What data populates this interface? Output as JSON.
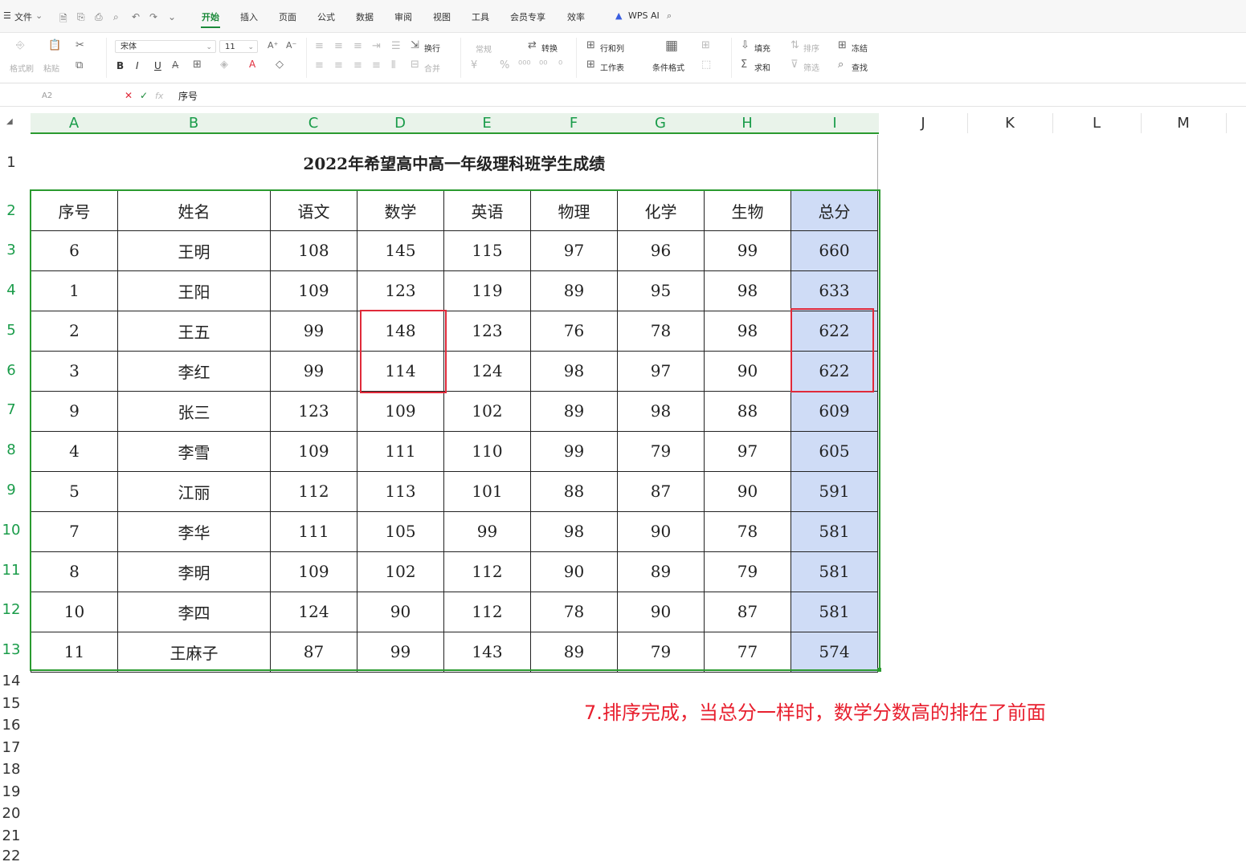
{
  "menubar": {
    "file_label": "文件",
    "tabs": [
      "开始",
      "插入",
      "页面",
      "公式",
      "数据",
      "审阅",
      "视图",
      "工具",
      "会员专享",
      "效率"
    ],
    "active_tab": "开始",
    "ai_label": "WPS AI"
  },
  "toolbar": {
    "format_painter": "格式刷",
    "paste": "粘贴",
    "font_name": "宋体",
    "font_size": "11",
    "bold": "B",
    "italic": "I",
    "underline": "U",
    "wrap": "换行",
    "merge": "合并",
    "number_format": "常规",
    "convert": "转换",
    "row_col": "行和列",
    "worksheet": "工作表",
    "cond_format": "条件格式",
    "fill": "填充",
    "sort": "排序",
    "freeze": "冻结",
    "sum": "求和",
    "filter": "筛选",
    "find": "查找"
  },
  "formula_bar": {
    "cell_ref": "A2",
    "fx": "fx",
    "value": "序号"
  },
  "columns": [
    "A",
    "B",
    "C",
    "D",
    "E",
    "F",
    "G",
    "H",
    "I",
    "J",
    "K",
    "L",
    "M"
  ],
  "rows": [
    "1",
    "2",
    "3",
    "4",
    "5",
    "6",
    "7",
    "8",
    "9",
    "10",
    "11",
    "12",
    "13",
    "14",
    "15",
    "16",
    "17",
    "18",
    "19",
    "20",
    "21",
    "22"
  ],
  "sheet": {
    "title": "2022年希望高中高一年级理科班学生成绩",
    "headers": [
      "序号",
      "姓名",
      "语文",
      "数学",
      "英语",
      "物理",
      "化学",
      "生物",
      "总分"
    ],
    "records": [
      [
        "6",
        "王明",
        "108",
        "145",
        "115",
        "97",
        "96",
        "99",
        "660"
      ],
      [
        "1",
        "王阳",
        "109",
        "123",
        "119",
        "89",
        "95",
        "98",
        "633"
      ],
      [
        "2",
        "王五",
        "99",
        "148",
        "123",
        "76",
        "78",
        "98",
        "622"
      ],
      [
        "3",
        "李红",
        "99",
        "114",
        "124",
        "98",
        "97",
        "90",
        "622"
      ],
      [
        "9",
        "张三",
        "123",
        "109",
        "102",
        "89",
        "98",
        "88",
        "609"
      ],
      [
        "4",
        "李雪",
        "109",
        "111",
        "110",
        "99",
        "79",
        "97",
        "605"
      ],
      [
        "5",
        "江丽",
        "112",
        "113",
        "101",
        "88",
        "87",
        "90",
        "591"
      ],
      [
        "7",
        "李华",
        "111",
        "105",
        "99",
        "98",
        "90",
        "78",
        "581"
      ],
      [
        "8",
        "李明",
        "109",
        "102",
        "112",
        "90",
        "89",
        "79",
        "581"
      ],
      [
        "10",
        "李四",
        "124",
        "90",
        "112",
        "78",
        "90",
        "87",
        "581"
      ],
      [
        "11",
        "王麻子",
        "87",
        "99",
        "143",
        "89",
        "79",
        "77",
        "574"
      ]
    ]
  },
  "annotation": "7.排序完成，当总分一样时，数学分数高的排在了前面",
  "colors": {
    "accent": "#1b8a3a",
    "highlight": "#cfdcf6",
    "annotation": "#e8202f"
  }
}
